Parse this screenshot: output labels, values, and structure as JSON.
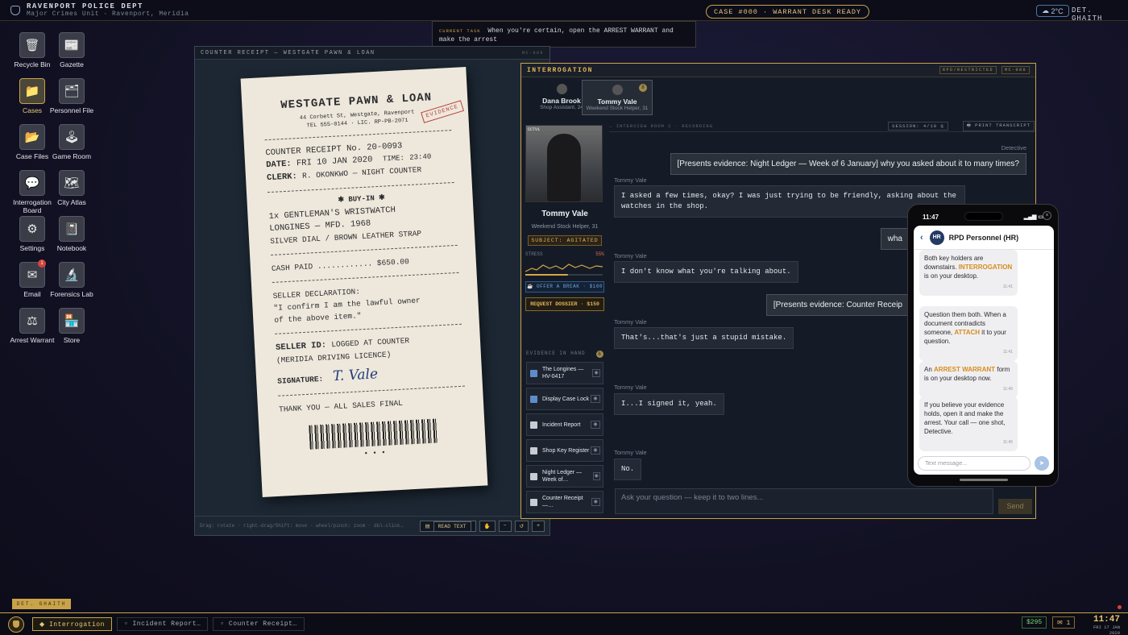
{
  "topbar": {
    "dept": "RAVENPORT POLICE DEPT",
    "unit": "Major Crimes Unit · Ravenport, Meridia",
    "case_status": "CASE #000 · WARRANT DESK READY",
    "weather": "2°C",
    "detective": "DET. GHAITH"
  },
  "current_task": {
    "label": "CURRENT TASK",
    "text": "When you're certain, open the ARREST WARRANT and make the arrest"
  },
  "desktop_icons": [
    {
      "label": "Recycle Bin",
      "glyph": "🗑"
    },
    {
      "label": "Gazette",
      "glyph": "📰"
    },
    {
      "label": "Cases",
      "glyph": "📁"
    },
    {
      "label": "Personnel File",
      "glyph": "🗂"
    },
    {
      "label": "Case Files",
      "glyph": "📂"
    },
    {
      "label": "Game Room",
      "glyph": "🕹"
    },
    {
      "label": "Interrogation Board",
      "glyph": "💬"
    },
    {
      "label": "City Atlas",
      "glyph": "🗺"
    },
    {
      "label": "Settings",
      "glyph": "⚙"
    },
    {
      "label": "Notebook",
      "glyph": "📓"
    },
    {
      "label": "Email",
      "glyph": "✉",
      "badge": "1"
    },
    {
      "label": "Forensics Lab",
      "glyph": "🔬"
    },
    {
      "label": "Arrest Warrant",
      "glyph": "⚖"
    },
    {
      "label": "Store",
      "glyph": "🏪"
    }
  ],
  "receipt_window": {
    "title": "COUNTER RECEIPT — WESTGATE PAWN & LOAN",
    "code": "MC-006",
    "store": "WESTGATE PAWN & LOAN",
    "stamp": "EVIDENCE",
    "address": "44 Corbett St, Westgate, Ravenport",
    "tel": "TEL 555-0144 · LIC. RP-PB-2071",
    "receipt_no": "COUNTER RECEIPT No. 20-0093",
    "date_label": "DATE:",
    "date": "FRI 10 JAN 2020",
    "time_label": "TIME:",
    "time": "23:40",
    "clerk_label": "CLERK:",
    "clerk": "R. OKONKWO — NIGHT COUNTER",
    "section": "✱ BUY-IN ✱",
    "item1": "1x GENTLEMAN'S WRISTWATCH",
    "item2": "LONGINES — MFD. 1968",
    "item3": "SILVER DIAL / BROWN LEATHER STRAP",
    "cash": "CASH PAID ............ $650.00",
    "decl_label": "SELLER DECLARATION:",
    "decl1": "\"I confirm I am the lawful owner",
    "decl2": "of the above item.\"",
    "seller_id_label": "SELLER ID:",
    "seller_id": "LOGGED AT COUNTER",
    "licence": "(MERIDIA DRIVING LICENCE)",
    "sig_label": "SIGNATURE:",
    "signature": "T. Vale",
    "thanks": "THANK YOU — ALL SALES FINAL",
    "dots": "• • •",
    "hint": "Drag: rotate · right-drag/Shift: move · wheel/pinch: zoom · dbl-click…",
    "read_text": "READ TEXT",
    "btn_hand": "✋",
    "btn_minus": "−",
    "btn_reset": "↺",
    "btn_plus": "+"
  },
  "interrogation": {
    "title": "INTERROGATION",
    "restricted": "RPD/RESTRICTED",
    "code": "MC-000",
    "suspects": [
      {
        "name": "Dana Brook",
        "role": "Shop Assistant, 24",
        "count": "2"
      },
      {
        "name": "Tommy Vale",
        "role": "Weekend Stock Helper, 31",
        "count": "8"
      }
    ],
    "cctv": "CCTV1",
    "subject_name": "Tommy Vale",
    "subject_role": "Weekend Stock Helper, 31",
    "subject_state": "SUBJECT: AGITATED",
    "stress_label": "STRESS",
    "stress_value": "55%",
    "stress_level": 0.55,
    "offer_break": "☕ OFFER A BREAK · $100",
    "dossier": "REQUEST DOSSIER · $150",
    "evidence_label": "EVIDENCE IN HAND",
    "evidence_count": "6",
    "evidence": [
      {
        "label": "The Longines — HV-0417",
        "type": "cube"
      },
      {
        "label": "Display Case Lock",
        "type": "cube"
      },
      {
        "label": "Incident Report",
        "type": "doc"
      },
      {
        "label": "Shop Key Register",
        "type": "doc"
      },
      {
        "label": "Night Ledger — Week of…",
        "type": "doc"
      },
      {
        "label": "Counter Receipt —…",
        "type": "doc"
      }
    ],
    "chat_head": "→ INTERVIEW ROOM 2 · RECORDING",
    "session": "SESSION: 4/10 Q",
    "print": "🖶 PRINT TRANSCRIPT",
    "messages": [
      {
        "speaker": "Detective",
        "text": "[Presents evidence: Night Ledger — Week of 6 January] why you asked about it to many times?",
        "who": "det"
      },
      {
        "speaker": "Tommy Vale",
        "text": "I asked a few times, okay? I was just trying to be friendly, asking about the watches in the shop.",
        "who": "sus"
      },
      {
        "speaker": "",
        "text": "wha",
        "who": "det"
      },
      {
        "speaker": "Tommy Vale",
        "text": "I don't know what you're talking about.",
        "who": "sus"
      },
      {
        "speaker": "",
        "text": "[Presents evidence: Counter Receip",
        "who": "det"
      },
      {
        "speaker": "Tommy Vale",
        "text": "That's...that's just a stupid mistake.",
        "who": "sus"
      },
      {
        "speaker": "Tommy Vale",
        "text": "I...I signed it, yeah.",
        "who": "sus"
      },
      {
        "speaker": "Tommy Vale",
        "text": "No.",
        "who": "sus"
      }
    ],
    "ask_placeholder": "Ask your question — keep it to two lines...",
    "send": "Send"
  },
  "phone": {
    "time": "11:47",
    "contact_initials": "HR",
    "contact": "RPD Personnel (HR)",
    "messages": [
      {
        "parts": [
          "Both key holders are downstairs. ",
          "INTERROGATION",
          " is on your desktop."
        ],
        "time": "11:41"
      },
      {
        "parts": [
          "Question them both. When a document contradicts someone, ",
          "ATTACH",
          " it to your question."
        ],
        "time": "11:41"
      },
      {
        "parts": [
          "An ",
          "ARREST WARRANT",
          " form is on your desktop now."
        ],
        "time": "11:45"
      },
      {
        "parts": [
          "If you believe your evidence holds, open it and make the arrest. Your call — one shot, Detective.",
          "",
          ""
        ],
        "time": "11:45"
      }
    ],
    "input_placeholder": "Text message..."
  },
  "taskbar": {
    "det_label": "DET. GHAITH",
    "items": [
      {
        "label": "◆ Interrogation",
        "active": true
      },
      {
        "label": "▫ Incident Report…",
        "active": false
      },
      {
        "label": "▫ Counter Receipt…",
        "active": false
      }
    ],
    "money": "$295",
    "mail": "✉ 1",
    "clock_time": "11:47",
    "clock_date": "FRI 17 JAN 2020"
  },
  "colors": {
    "accent": "#c9a34a",
    "danger": "#d2443c"
  }
}
